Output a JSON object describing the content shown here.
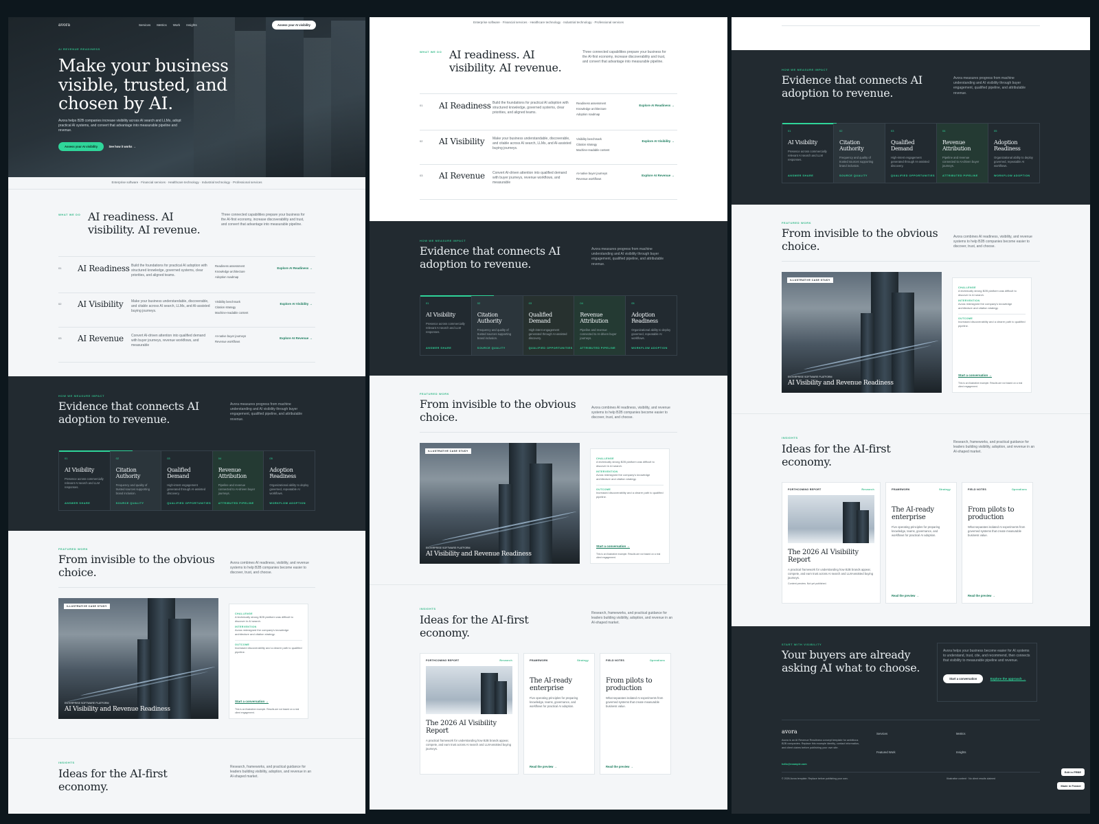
{
  "brand": "avora",
  "nav": {
    "items": [
      "Services",
      "Metrics",
      "Work",
      "Insights"
    ],
    "cta": "Assess your AI visibility"
  },
  "hero": {
    "eyebrow": "AI REVENUE READINESS",
    "title": "Make your business visible, trusted, and chosen by AI.",
    "text": "Avora helps B2B companies increase visibility across AI search and LLMs, adopt practical AI systems, and convert that advantage into measurable pipeline and revenue.",
    "primary": "Assess your AI visibility",
    "secondary": "See how it works →"
  },
  "industries": "Enterprise software · Financial services · Healthcare technology · Industrial technology · Professional services",
  "services": {
    "eyebrow": "WHAT WE DO",
    "title": "AI readiness. AI visibility. AI revenue.",
    "intro": "Three connected capabilities prepare your business for the AI-first economy, increase discoverability and trust, and convert that advantage into measurable pipeline.",
    "rows": [
      {
        "num": "01",
        "title": "AI Readiness",
        "desc": "Build the foundations for practical AI adoption with structured knowledge, governed systems, clear priorities, and aligned teams.",
        "bullets": [
          "Readiness assessment",
          "Knowledge architecture",
          "Adoption roadmap"
        ],
        "link": "Explore AI Readiness →"
      },
      {
        "num": "02",
        "title": "AI Visibility",
        "desc": "Make your business understandable, discoverable, and citable across AI search, LLMs, and AI-assisted buying journeys.",
        "bullets": [
          "Visibility benchmark",
          "Citation strategy",
          "Machine-readable content"
        ],
        "link": "Explore AI Visibility →"
      },
      {
        "num": "03",
        "title": "AI Revenue",
        "desc": "Convert AI-driven attention into qualified demand with buyer journeys, revenue workflows, and measurable",
        "bullets": [
          "AI-native buyer journeys",
          "Revenue workflows"
        ],
        "link": "Explore AI Revenue →"
      }
    ]
  },
  "impact": {
    "eyebrow": "HOW WE MEASURE IMPACT",
    "title": "Evidence that connects AI adoption to revenue.",
    "intro": "Avora measures progress from machine understanding and AI visibility through buyer engagement, qualified pipeline, and attributable revenue.",
    "cards": [
      {
        "num": "01",
        "title": "AI Visibility",
        "desc": "Presence across commercially relevant AI search and LLM responses.",
        "tag": "ANSWER SHARE"
      },
      {
        "num": "02",
        "title": "Citation Authority",
        "desc": "Frequency and quality of trusted sources supporting brand inclusion.",
        "tag": "SOURCE QUALITY"
      },
      {
        "num": "03",
        "title": "Qualified Demand",
        "desc": "High-intent engagement generated through AI-assisted discovery.",
        "tag": "QUALIFIED OPPORTUNITIES"
      },
      {
        "num": "04",
        "title": "Revenue Attribution",
        "desc": "Pipeline and revenue connected to AI-driven buyer journeys.",
        "tag": "ATTRIBUTED PIPELINE"
      },
      {
        "num": "05",
        "title": "Adoption Readiness",
        "desc": "Organizational ability to deploy governed, repeatable AI workflows.",
        "tag": "WORKFLOW ADOPTION"
      }
    ]
  },
  "work": {
    "eyebrow": "FEATURED WORK",
    "title": "From invisible to the obvious choice.",
    "intro": "Avora combines AI readiness, visibility, and revenue systems to help B2B companies become easier to discover, trust, and choose.",
    "badge": "ILLUSTRATIVE CASE STUDY",
    "case_sub": "ENTERPRISE SOFTWARE PLATFORM",
    "case_title": "AI Visibility and Revenue Readiness",
    "challenge_label": "CHALLENGE",
    "challenge": "A technically strong B2B platform was difficult to discover in AI search.",
    "intervention_label": "INTERVENTION",
    "intervention": "Avora redesigned the company's knowledge architecture and citation strategy.",
    "outcome_label": "OUTCOME",
    "outcome": "Increased discoverability and a clearer path to qualified pipeline.",
    "link": "Start a conversation →",
    "note": "This is an illustrative example. Results are not based on a real client engagement."
  },
  "insights": {
    "eyebrow": "INSIGHTS",
    "title": "Ideas for the AI-first economy.",
    "intro": "Research, frameworks, and practical guidance for leaders building visibility, adoption, and revenue in an AI-shaped market.",
    "cards": [
      {
        "type": "FORTHCOMING REPORT",
        "cat": "Research",
        "title": "The 2026 AI Visibility Report",
        "desc": "A practical framework for understanding how B2B brands appear, compete, and earn trust across AI search and LLM-assisted buying journeys.",
        "link": "Read the preview →",
        "note": "Content preview. Not yet published."
      },
      {
        "type": "FRAMEWORK",
        "cat": "Strategy",
        "title": "The AI-ready enterprise",
        "desc": "Five operating principles for preparing knowledge, teams, governance, and workflows for practical AI adoption.",
        "link": "Read the preview →"
      },
      {
        "type": "FIELD NOTES",
        "cat": "Operations",
        "title": "From pilots to production",
        "desc": "What separates isolated AI experiments from governed systems that create measurable business value.",
        "link": "Read the preview →"
      }
    ]
  },
  "cta": {
    "eyebrow": "START WITH VISIBILITY",
    "title": "Your buyers are already asking AI what to choose.",
    "text": "Avora helps your business become easier for AI systems to understand, trust, cite, and recommend, then connects that visibility to measurable pipeline and revenue.",
    "primary": "Start a conversation",
    "secondary": "Explore the approach →"
  },
  "footer": {
    "blurb": "Avora is an AI Revenue Readiness concept template for ambitious B2B companies. Replace this example identity, contact information, and client claims before publishing your own site.",
    "email": "hello@example.com",
    "links": [
      "Services",
      "Metrics",
      "Featured Work",
      "Insights"
    ],
    "copyright": "© 2026 Avora template. Replace before publishing your own.",
    "disclaimer": "Illustrative content · No client results claimed"
  },
  "floating": {
    "edit": "Edit in FRBE",
    "made": "Made in Framer"
  },
  "colors": {
    "accent": "#2fd69a",
    "dark": "#222a30",
    "bg": "#0d171d"
  }
}
